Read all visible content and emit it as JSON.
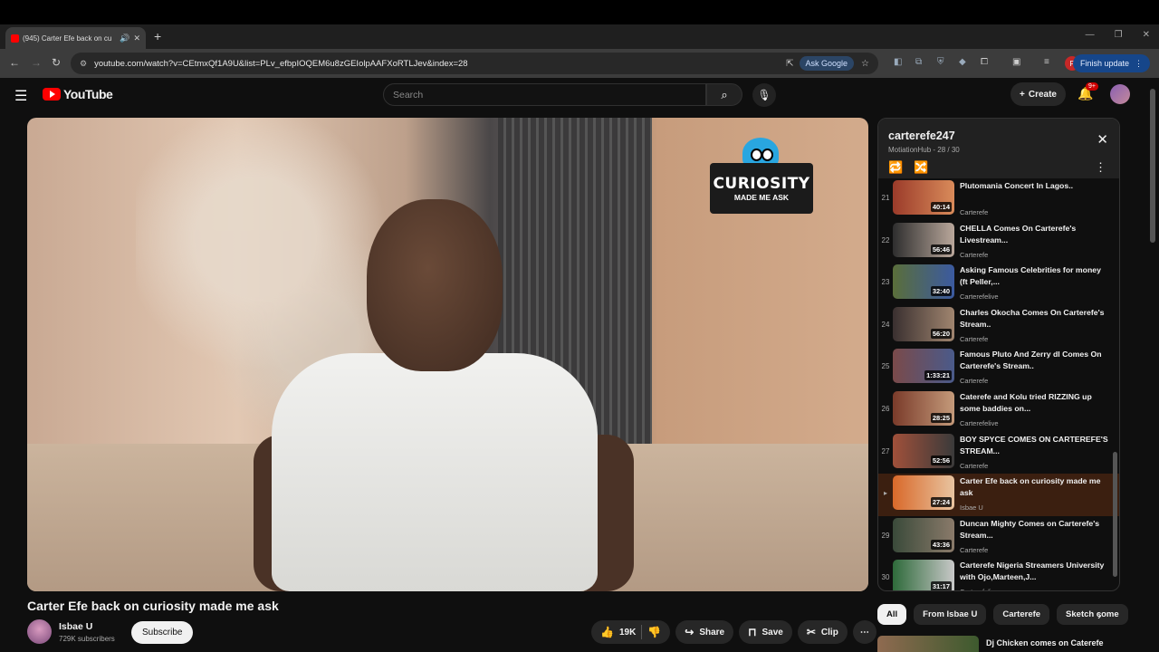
{
  "browser": {
    "tab_title": "(945) Carter Efe back on cu",
    "url": "youtube.com/watch?v=CEtmxQf1A9U&list=PLv_efbpIOQEM6u8zGEIolpAAFXoRTLJev&index=28",
    "ask_google": "Ask Google",
    "finish_update": "Finish update",
    "profile_initial": "P"
  },
  "header": {
    "logo_text": "YouTube",
    "search_placeholder": "Search",
    "create_label": "Create",
    "notif_count": "9+"
  },
  "video": {
    "overlay_logo_big": "CURIOSITY",
    "overlay_logo_small": "MADE ME ASK",
    "title": "Carter Efe back on curiosity made me ask",
    "channel": "Isbae U",
    "subscribers": "729K subscribers",
    "subscribe_label": "Subscribe",
    "likes": "19K",
    "share_label": "Share",
    "save_label": "Save",
    "clip_label": "Clip"
  },
  "playlist": {
    "title": "carterefe247",
    "subtitle": "MotiationHub - 28 / 30",
    "items": [
      {
        "index": "21",
        "title": "Plutomania Concert In Lagos..",
        "channel": "Carterefe",
        "duration": "40:14",
        "colors": [
          "#9b3b2a",
          "#d98b5a"
        ]
      },
      {
        "index": "22",
        "title": "CHELLA Comes On Carterefe's Livestream...",
        "channel": "Carterefe",
        "duration": "56:46",
        "colors": [
          "#2e2e2e",
          "#b9a79b"
        ]
      },
      {
        "index": "23",
        "title": "Asking Famous Celebrities for money (ft Peller,...",
        "channel": "Carterefelive",
        "duration": "32:40",
        "colors": [
          "#5a6e3a",
          "#3b5aa0"
        ]
      },
      {
        "index": "24",
        "title": "Charles Okocha Comes On Carterefe's Stream..",
        "channel": "Carterefe",
        "duration": "56:20",
        "colors": [
          "#3a3030",
          "#a0856f"
        ]
      },
      {
        "index": "25",
        "title": "Famous Pluto And Zerry dl Comes On Carterefe's Stream..",
        "channel": "Carterefe",
        "duration": "1:33:21",
        "colors": [
          "#7a4a4a",
          "#4a5a8a"
        ]
      },
      {
        "index": "26",
        "title": "Caterefe and Kolu tried RIZZING up some baddies on...",
        "channel": "Carterefelive",
        "duration": "28:25",
        "colors": [
          "#7a3b2a",
          "#c49a7a"
        ]
      },
      {
        "index": "27",
        "title": "BOY SPYCE COMES ON CARTEREFE'S STREAM...",
        "channel": "Carterefe",
        "duration": "52:56",
        "colors": [
          "#a0503a",
          "#3a3a3a"
        ]
      },
      {
        "index": "▸",
        "title": "Carter Efe back on curiosity made me ask",
        "channel": "Isbae U",
        "duration": "27:24",
        "colors": [
          "#d9692a",
          "#e8c4a0"
        ]
      },
      {
        "index": "29",
        "title": "Duncan Mighty Comes on Carterefe's Stream...",
        "channel": "Carterefe",
        "duration": "43:36",
        "colors": [
          "#3a4a3a",
          "#8a7a6a"
        ]
      },
      {
        "index": "30",
        "title": "Carterefe Nigeria Streamers University with Ojo,Marteen,J...",
        "channel": "Carterefelive",
        "duration": "31:17",
        "colors": [
          "#2e6a3a",
          "#c8c8c8"
        ]
      }
    ]
  },
  "chips": [
    "All",
    "From Isbae U",
    "Carterefe",
    "Sketch come"
  ],
  "next_video_title": "Dj Chicken comes on Caterefe"
}
